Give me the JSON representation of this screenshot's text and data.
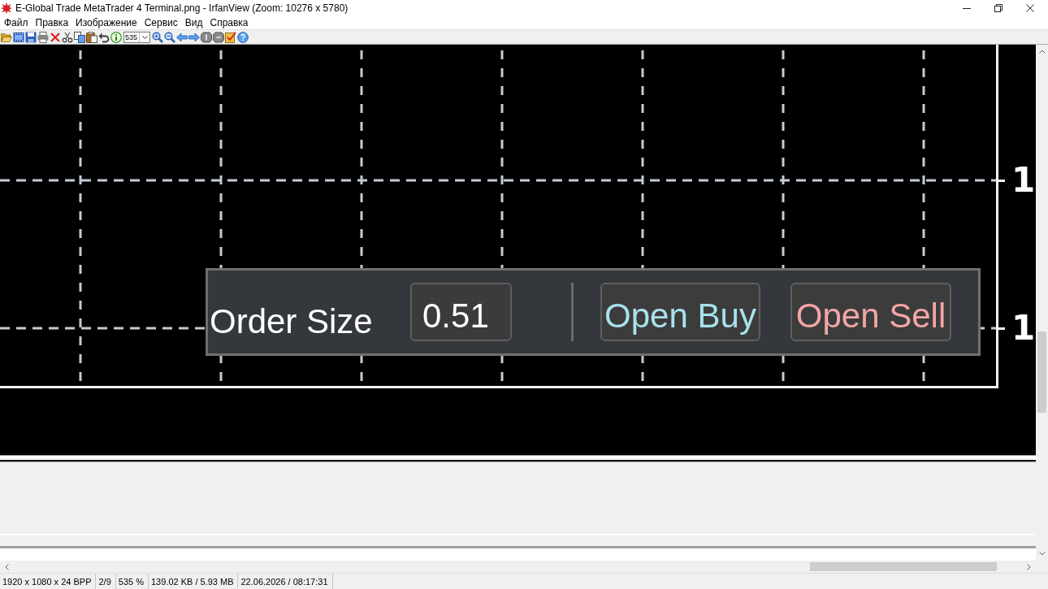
{
  "window": {
    "title": "E-Global Trade MetaTrader 4 Terminal.png - IrfanView (Zoom: 10276 x 5780)"
  },
  "menu": [
    "Файл",
    "Правка",
    "Изображение",
    "Сервис",
    "Вид",
    "Справка"
  ],
  "toolbar": {
    "zoom": "535"
  },
  "image": {
    "price_labels": [
      "1",
      "1"
    ],
    "order_panel": {
      "label": "Order Size",
      "order_size": "0.51",
      "buttons": [
        {
          "label": "Open Buy",
          "color": "#a8e2ec"
        },
        {
          "label": "Open Sell",
          "color": "#f2a6a6"
        }
      ]
    }
  },
  "status_bar": [
    "1920 x 1080 x 24 BPP",
    "2/9",
    "535 %",
    "139.02 KB / 5.93 MB",
    "22.06.2026 / 08:17:31"
  ]
}
